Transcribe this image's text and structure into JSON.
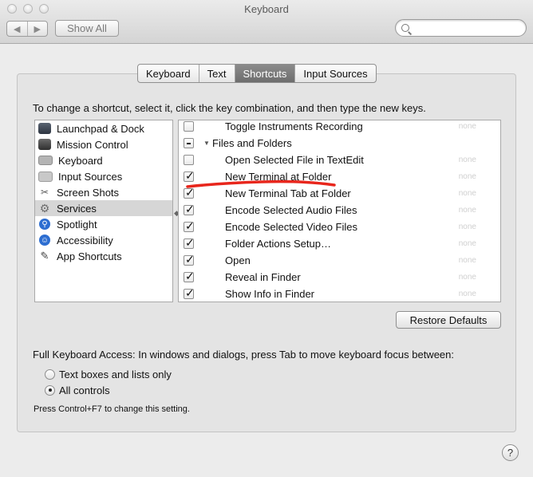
{
  "window": {
    "title": "Keyboard"
  },
  "toolbar": {
    "back_glyph": "◀",
    "forward_glyph": "▶",
    "show_all": "Show All",
    "search_placeholder": ""
  },
  "tabs": [
    {
      "label": "Keyboard",
      "active": false
    },
    {
      "label": "Text",
      "active": false
    },
    {
      "label": "Shortcuts",
      "active": true
    },
    {
      "label": "Input Sources",
      "active": false
    }
  ],
  "instructions": "To change a shortcut, select it, click the key combination, and then type the new keys.",
  "categories": [
    {
      "label": "Launchpad & Dock",
      "icon": "launchpad-icon"
    },
    {
      "label": "Mission Control",
      "icon": "mission-control-icon"
    },
    {
      "label": "Keyboard",
      "icon": "keyboard-icon"
    },
    {
      "label": "Input Sources",
      "icon": "input-sources-icon"
    },
    {
      "label": "Screen Shots",
      "icon": "screenshot-icon"
    },
    {
      "label": "Services",
      "icon": "gear-icon",
      "selected": true
    },
    {
      "label": "Spotlight",
      "icon": "spotlight-icon"
    },
    {
      "label": "Accessibility",
      "icon": "accessibility-icon"
    },
    {
      "label": "App Shortcuts",
      "icon": "app-shortcuts-icon"
    }
  ],
  "shortcuts": [
    {
      "label": "Toggle Instruments Recording",
      "state": "unchecked",
      "key": "none",
      "group": false
    },
    {
      "label": "Files and Folders",
      "state": "mixed",
      "key": "",
      "group": true
    },
    {
      "label": "Open Selected File in TextEdit",
      "state": "unchecked",
      "key": "none",
      "group": false
    },
    {
      "label": "New Terminal at Folder",
      "state": "checked",
      "key": "none",
      "group": false
    },
    {
      "label": "New Terminal Tab at Folder",
      "state": "checked",
      "key": "none",
      "group": false
    },
    {
      "label": "Encode Selected Audio Files",
      "state": "checked",
      "key": "none",
      "group": false
    },
    {
      "label": "Encode Selected Video Files",
      "state": "checked",
      "key": "none",
      "group": false
    },
    {
      "label": "Folder Actions Setup…",
      "state": "checked",
      "key": "none",
      "group": false
    },
    {
      "label": "Open",
      "state": "checked",
      "key": "none",
      "group": false
    },
    {
      "label": "Reveal in Finder",
      "state": "checked",
      "key": "none",
      "group": false
    },
    {
      "label": "Show Info in Finder",
      "state": "checked",
      "key": "none",
      "group": false
    }
  ],
  "annotation": {
    "color": "#e8261c"
  },
  "restore_defaults": "Restore Defaults",
  "full_keyboard_access": {
    "label": "Full Keyboard Access: In windows and dialogs, press Tab to move keyboard focus between:",
    "options": [
      {
        "label": "Text boxes and lists only",
        "selected": false
      },
      {
        "label": "All controls",
        "selected": true
      }
    ],
    "hint": "Press Control+F7 to change this setting."
  },
  "help": "?"
}
